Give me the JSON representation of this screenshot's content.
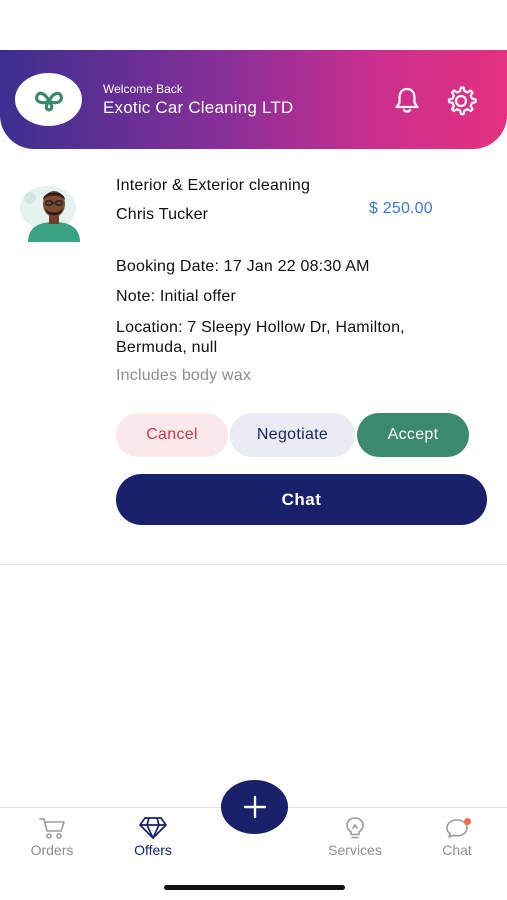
{
  "header": {
    "welcome": "Welcome Back",
    "company": "Exotic Car Cleaning LTD",
    "logo_icon": "link-logo-icon",
    "notification_icon": "bell-icon",
    "settings_icon": "gear-icon",
    "gradient_colors": [
      "#3b2f8f",
      "#cc2f8e",
      "#e3317f"
    ]
  },
  "offer": {
    "service": "Interior & Exterior cleaning",
    "customer": "Chris Tucker",
    "price": "$ 250.00",
    "booking": "Booking Date: 17 Jan 22 08:30 AM",
    "note": "Note: Initial offer",
    "location": "Location: 7 Sleepy Hollow Dr, Hamilton, Bermuda, null",
    "extra": "Includes body wax",
    "actions": {
      "cancel": "Cancel",
      "negotiate": "Negotiate",
      "accept": "Accept",
      "chat": "Chat"
    }
  },
  "tabs": {
    "orders": "Orders",
    "offers": "Offers",
    "services": "Services",
    "chat": "Chat"
  },
  "colors": {
    "primary": "#18216a",
    "accept": "#3b8a6c",
    "cancel": "#c73a4c",
    "price": "#3c78d8"
  }
}
